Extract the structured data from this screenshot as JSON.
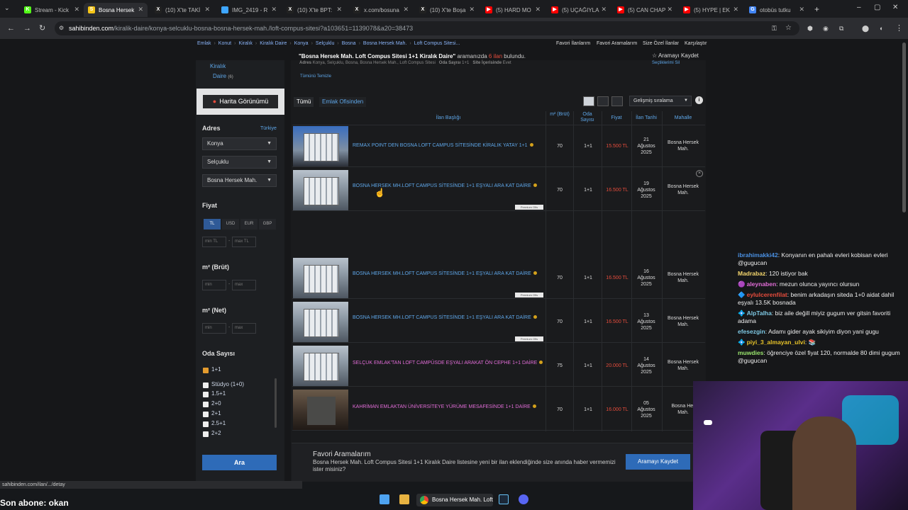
{
  "browser": {
    "tabs": [
      {
        "label": "Stream - Kick",
        "color": "#53fc18",
        "glyph": "K",
        "active": false
      },
      {
        "label": "Bosna Hersek",
        "color": "#f5c518",
        "glyph": "S",
        "active": true
      },
      {
        "label": "(10) X'te TAKİ",
        "color": "#222",
        "glyph": "X",
        "active": false
      },
      {
        "label": "IMG_2419 - R",
        "color": "#3ea6ff",
        "glyph": "",
        "active": false
      },
      {
        "label": "(10) X'te BPT:",
        "color": "#222",
        "glyph": "X",
        "active": false
      },
      {
        "label": "x.com/bosuna",
        "color": "#222",
        "glyph": "X",
        "active": false
      },
      {
        "label": "(10) X'te Boşa",
        "color": "#222",
        "glyph": "X",
        "active": false
      },
      {
        "label": "(5) HARD MO",
        "color": "#ff0000",
        "glyph": "▶",
        "active": false
      },
      {
        "label": "(5) UÇAĞIYLA",
        "color": "#ff0000",
        "glyph": "▶",
        "active": false
      },
      {
        "label": "(5) CAN CHAP",
        "color": "#ff0000",
        "glyph": "▶",
        "active": false
      },
      {
        "label": "(5) HYPE | EK",
        "color": "#ff0000",
        "glyph": "▶",
        "active": false
      },
      {
        "label": "otobüs tutku",
        "color": "#4285f4",
        "glyph": "G",
        "active": false
      }
    ],
    "url_domain": "sahibinden.com",
    "url_path": "/kiralik-daire/konya-selcuklu-bosna-bosna-hersek-mah./loft-compus-sitesi?a103651=1139078&a20=38473"
  },
  "breadcrumb": [
    "Emlak",
    "Konut",
    "Kiralık",
    "Kiralık Daire",
    "Konya",
    "Selçuklu",
    "Bosna",
    "Bosna Hersek Mah.",
    "Loft Compus Sitesi..."
  ],
  "top_links": [
    "Favori İlanlarım",
    "Favori Aramalarım",
    "Size Özel İlanlar",
    "Karşılaştır"
  ],
  "result_info": {
    "query": "\"Bosna Hersek Mah. Loft Compus Sitesi 1+1 Kiralık Daire\"",
    "mid": " aramanızda ",
    "count": "6 ilan",
    "tail": " bulundu."
  },
  "save_search": "☆ Aramayı Kaydet",
  "sidebar": {
    "category": "Kiralık",
    "category2": "Daire",
    "category2_count": "(6)",
    "map_button": "Harita Görünümü",
    "address_title": "Adres",
    "country_link": "Türkiye",
    "selects": [
      "Konya",
      "Selçuklu",
      "Bosna Hersek Mah."
    ],
    "price_title": "Fiyat",
    "currencies": [
      "TL",
      "USD",
      "EUR",
      "GBP"
    ],
    "price_min": "min TL",
    "price_max": "max TL",
    "gross_title": "m² (Brüt)",
    "net_title": "m² (Net)",
    "min": "min",
    "max": "max",
    "rooms_title": "Oda Sayısı",
    "rooms": [
      {
        "label": "1+1",
        "checked": true
      },
      {
        "label": "Stüdyo (1+0)",
        "checked": false
      },
      {
        "label": "1.5+1",
        "checked": false
      },
      {
        "label": "2+0",
        "checked": false
      },
      {
        "label": "2+1",
        "checked": false
      },
      {
        "label": "2.5+1",
        "checked": false
      },
      {
        "label": "2+2",
        "checked": false
      }
    ],
    "search_button": "Ara"
  },
  "filter_bar": {
    "address_label": "Adres",
    "address_value": "Konya, Selçuklu, Bosna, Bosna Hersek Mah., Loft Compus Sitesi",
    "rooms_label": "Oda Sayısı",
    "rooms_value": "1+1",
    "site_label": "Site İçerisinde",
    "site_value": "Evet",
    "clear": "Tümünü Temizle",
    "selected": "Seçtiklerimi Sil"
  },
  "tabs": [
    "Tümü",
    "Emlak Ofisinden"
  ],
  "sort_label": "Gelişmiş sıralama",
  "columns": [
    "İlan Başlığı",
    "m² (Brüt)",
    "Oda Sayısı",
    "Fiyat",
    "İlan Tarihi",
    "Mahalle"
  ],
  "listings": [
    {
      "title": "REMAX POINT DEN BOSNA LOFT CAMPUS SİTESİNDE KİRALIK YATAY 1+1",
      "m2": "70",
      "rooms": "1+1",
      "price": "15.500 TL",
      "d1": "21",
      "d2": "Ağustos",
      "d3": "2025",
      "n1": "Bosna Hersek",
      "n2": "Mah.",
      "premium": false,
      "pink": false,
      "thumb": "blue"
    },
    {
      "title": "BOSNA HERSEK MH.LOFT CAMPUS SİTESİNDE 1+1 EŞYALI ARA KAT DAİRE",
      "m2": "70",
      "rooms": "1+1",
      "price": "16.500 TL",
      "d1": "19",
      "d2": "Ağustos",
      "d3": "2025",
      "n1": "Bosna Hersek",
      "n2": "Mah.",
      "premium": true,
      "pink": false,
      "thumb": "bld"
    },
    {
      "title": "BOSNA HERSEK MH.LOFT CAMPUS SİTESİNDE 1+1 EŞYALI ARA KAT DAİRE",
      "m2": "70",
      "rooms": "1+1",
      "price": "16.500 TL",
      "d1": "16",
      "d2": "Ağustos",
      "d3": "2025",
      "n1": "Bosna Hersek",
      "n2": "Mah.",
      "premium": true,
      "pink": false,
      "thumb": "bld"
    },
    {
      "title": "BOSNA HERSEK MH.LOFT CAMPUS SİTESİNDE 1+1 EŞYALI ARA KAT DAİRE",
      "m2": "70",
      "rooms": "1+1",
      "price": "16.500 TL",
      "d1": "13",
      "d2": "Ağustos",
      "d3": "2025",
      "n1": "Bosna Hersek",
      "n2": "Mah.",
      "premium": true,
      "pink": false,
      "thumb": "bld"
    },
    {
      "title": "SELÇUK EMLAK'TAN LOFT CAMPÜSDE EŞYALI ARAKAT ÖN CEPHE 1+1 DAİRE",
      "m2": "75",
      "rooms": "1+1",
      "price": "20.000 TL",
      "d1": "14",
      "d2": "Ağustos",
      "d3": "2025",
      "n1": "Bosna Hersek",
      "n2": "Mah.",
      "premium": false,
      "pink": true,
      "thumb": "bld"
    },
    {
      "title": "KAHRİMAN EMLAKTAN ÜNİVERSİTEYE YÜRÜME MESAFESİNDE 1+1 DAİRE",
      "m2": "70",
      "rooms": "1+1",
      "price": "16.000 TL",
      "d1": "05",
      "d2": "Ağustos",
      "d3": "2025",
      "n1": "Bosna Her",
      "n2": "Mah.",
      "premium": false,
      "pink": true,
      "thumb": "room"
    }
  ],
  "premium_badge": "Premium Ofis",
  "fav": {
    "title": "Favori Aramalarım",
    "desc": "Bosna Hersek Mah. Loft Compus Sitesi 1+1 Kiralık Daire listesine yeni bir ilan eklendiğinde size anında haber vermemizi ister misiniz?",
    "button": "Aramayı Kaydet"
  },
  "chat": [
    {
      "user": "ibrahimakki42",
      "color": "#4a90e2",
      "text": ": Konyanın en pahalı evleri kobisan evleri @gugucan",
      "badge": ""
    },
    {
      "user": "Madrabaz",
      "color": "#f5d76e",
      "text": ": 120 istiyor bak",
      "badge": ""
    },
    {
      "user": "aleynaben",
      "color": "#e06cd6",
      "text": ": mezun olunca yayıncı olursun",
      "badge": "🟣"
    },
    {
      "user": "eylulcerenfilat",
      "color": "#e74c3c",
      "text": ": benim arkadaşın siteda 1+0 aidat dahil eşyalı 13.5K bosnada",
      "badge": "🔷"
    },
    {
      "user": "AlpTalha",
      "color": "#7ec8e3",
      "text": ": biz aile değill miyiz gugum ver gitsin favoriti adama",
      "badge": "💠"
    },
    {
      "user": "efesezgin",
      "color": "#7ec8e3",
      "text": ": Adamı gider ayak sikiyim diyon yani gugu",
      "badge": ""
    },
    {
      "user": "piyi_3_almayan_ulvi",
      "color": "#e6c229",
      "text": ": 📚",
      "badge": "💠"
    },
    {
      "user": "muwdies",
      "color": "#9ae66e",
      "text": ": öğrenciye özel fiyat 120, normalde 80 dimi gugum @gugucan",
      "badge": ""
    }
  ],
  "status_url": "sahibinden.com/ilan/.../detay",
  "overlay_text": "Son abone: okan",
  "taskbar_app": "Bosna Hersek Mah. Loft"
}
